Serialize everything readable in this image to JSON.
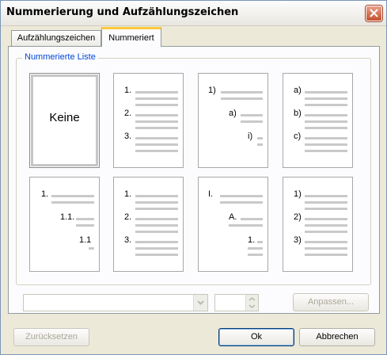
{
  "window": {
    "title": "Nummerierung und Aufzählungszeichen"
  },
  "tabs": [
    {
      "label": "Aufzählungszeichen",
      "active": false
    },
    {
      "label": "Nummeriert",
      "active": true
    }
  ],
  "group_label": "Nummerierte Liste",
  "cells": [
    {
      "id": "keine",
      "label": "Keine",
      "selected": true
    },
    {
      "id": "arabic",
      "markers": [
        "1.",
        "2.",
        "3."
      ]
    },
    {
      "id": "outline-mixed",
      "markers": [
        "1)",
        "a)",
        "i)"
      ]
    },
    {
      "id": "alpha",
      "markers": [
        "a)",
        "b)",
        "c)"
      ]
    },
    {
      "id": "outline-decimal",
      "markers": [
        "1.",
        "1.1.",
        "1.1"
      ]
    },
    {
      "id": "arabic-2",
      "markers": [
        "1.",
        "2.",
        "3."
      ]
    },
    {
      "id": "outline-roman",
      "markers": [
        "I.",
        "A.",
        "1."
      ]
    },
    {
      "id": "arabic-paren",
      "markers": [
        "1)",
        "2)",
        "3)"
      ]
    }
  ],
  "buttons": {
    "customize": "Anpassen...",
    "reset": "Zurücksetzen",
    "ok": "Ok",
    "cancel": "Abbrechen"
  },
  "colors": {
    "accent_tab": "#ffc83c",
    "legend": "#0046d5",
    "close": "#c4502f"
  }
}
